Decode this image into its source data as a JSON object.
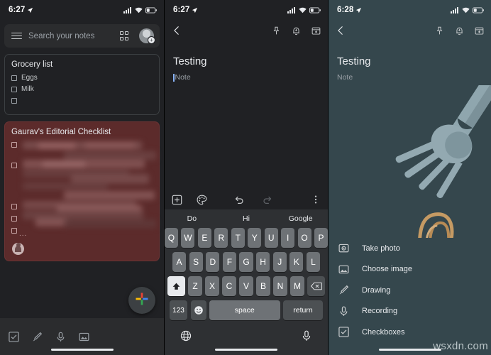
{
  "colors": {
    "panel_dark_bg": "#202124",
    "panel_teal_bg": "#35474d",
    "note_red_bg": "#5c2b2b",
    "keyboard_bg": "#2e3033",
    "key_bg": "#6e7276",
    "accent_caret": "#8ab4f8",
    "text_primary": "#e8eaed",
    "text_secondary": "#9aa0a6"
  },
  "panel1": {
    "status": {
      "time": "6:27",
      "location_icon": "location-arrow-icon",
      "signal_icon": "signal-bars-icon",
      "wifi_icon": "wifi-icon",
      "battery_icon": "battery-icon"
    },
    "search": {
      "menu_icon": "hamburger-menu-icon",
      "placeholder": "Search your notes",
      "grid_icon": "grid-view-icon",
      "avatar_icon": "account-avatar-icon"
    },
    "notes": [
      {
        "title": "Grocery list",
        "items": [
          {
            "label": "Eggs",
            "checked": false
          },
          {
            "label": "Milk",
            "checked": false
          },
          {
            "label": "",
            "checked": false
          }
        ]
      },
      {
        "title": "Gaurav's Editorial Checklist",
        "redacted": true,
        "overflow_indicator": "...",
        "items": [
          {
            "label": "",
            "checked": false
          },
          {
            "label": "",
            "checked": false
          },
          {
            "label": "",
            "checked": false
          },
          {
            "label": "",
            "checked": false
          },
          {
            "label": "",
            "checked": false
          }
        ],
        "collaborator_icon": "collaborator-avatar-icon"
      }
    ],
    "bottom_toolbar": [
      {
        "name": "new-checklist-icon"
      },
      {
        "name": "new-drawing-icon"
      },
      {
        "name": "new-recording-icon"
      },
      {
        "name": "new-image-icon"
      }
    ],
    "fab": {
      "name": "new-note-fab",
      "icon": "google-plus-icon"
    }
  },
  "panel2": {
    "status": {
      "time": "6:27"
    },
    "topbar": {
      "back_icon": "back-arrow-icon",
      "pin_icon": "pin-icon",
      "reminder_icon": "reminder-bell-icon",
      "archive_icon": "archive-icon"
    },
    "note": {
      "title": "Testing",
      "body_placeholder": "Note"
    },
    "edit_toolbar": [
      {
        "name": "add-attachment-icon"
      },
      {
        "name": "color-palette-icon"
      },
      {
        "name": "undo-icon"
      },
      {
        "name": "redo-icon"
      },
      {
        "name": "overflow-menu-icon"
      }
    ],
    "keyboard": {
      "suggestions": [
        "Do",
        "Hi",
        "Google"
      ],
      "row1": [
        "Q",
        "W",
        "E",
        "R",
        "T",
        "Y",
        "U",
        "I",
        "O",
        "P"
      ],
      "row2": [
        "A",
        "S",
        "D",
        "F",
        "G",
        "H",
        "J",
        "K",
        "L"
      ],
      "row3": [
        "Z",
        "X",
        "C",
        "V",
        "B",
        "N",
        "M"
      ],
      "shift_key": "shift-key-icon",
      "backspace_key": "backspace-key-icon",
      "numbers_key": "123",
      "emoji_key": "emoji-key-icon",
      "space_key": "space",
      "return_key": "return",
      "globe_icon": "globe-language-icon",
      "mic_icon": "voice-input-icon"
    }
  },
  "panel3": {
    "status": {
      "time": "6:28"
    },
    "topbar": {
      "back_icon": "back-arrow-icon",
      "pin_icon": "pin-icon",
      "reminder_icon": "reminder-bell-icon",
      "archive_icon": "archive-icon"
    },
    "note": {
      "title": "Testing",
      "body_placeholder": "Note"
    },
    "illustration": "fork-with-pasta-illustration",
    "menu": [
      {
        "label": "Take photo",
        "icon": "camera-icon"
      },
      {
        "label": "Choose image",
        "icon": "image-icon"
      },
      {
        "label": "Drawing",
        "icon": "brush-icon"
      },
      {
        "label": "Recording",
        "icon": "microphone-icon"
      },
      {
        "label": "Checkboxes",
        "icon": "checkbox-icon"
      }
    ],
    "watermark": "wsxdn.com"
  }
}
